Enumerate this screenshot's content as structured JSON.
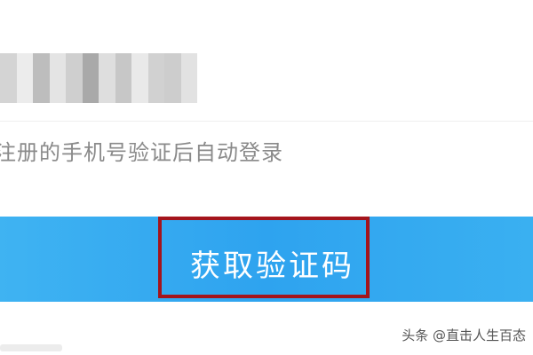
{
  "phone_field": {
    "blur_colors": [
      "#d4d4d4",
      "#ececec",
      "#bdbdbd",
      "#e4e4e4",
      "#cfcfcf",
      "#a9a9a9",
      "#dedede",
      "#c7c7c7",
      "#e9e9e9",
      "#d1d1d1",
      "#cdcdcd",
      "#e2e2e2"
    ]
  },
  "hint": {
    "text": "注册的手机号验证后自动登录"
  },
  "action_button": {
    "label": "获取验证码",
    "color": "#2ea3ef",
    "highlight_color": "#a4141c"
  },
  "watermark": {
    "text": "头条 @直击人生百态"
  }
}
